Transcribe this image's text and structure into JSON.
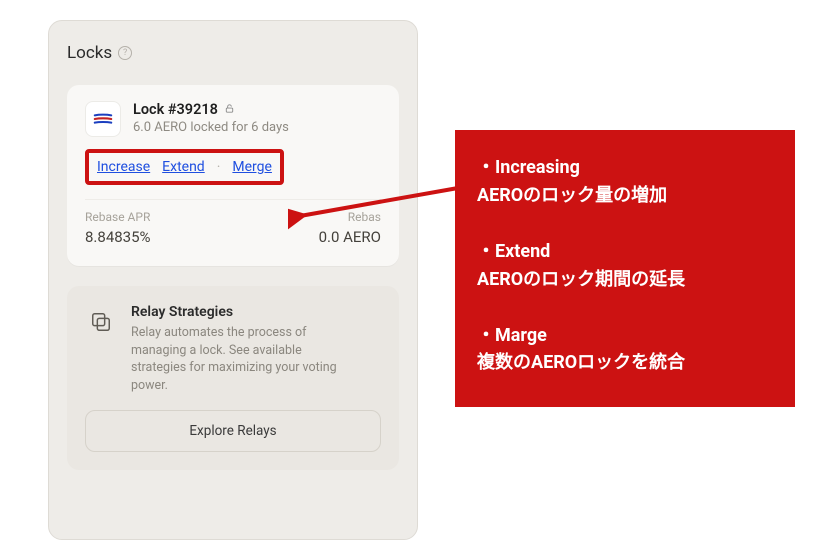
{
  "panel": {
    "title": "Locks"
  },
  "lock": {
    "title": "Lock #39218",
    "subtitle": "6.0 AERO locked for 6 days",
    "actions": {
      "increase": "Increase",
      "extend": "Extend",
      "merge": "Merge"
    },
    "stats": {
      "apr_label": "Rebase APR",
      "apr_value": "8.84835%",
      "reb_label": "Rebas",
      "reb_value": "0.0 AERO"
    }
  },
  "relay": {
    "title": "Relay Strategies",
    "desc": "Relay automates the process of managing a lock. See available strategies for maximizing your voting power.",
    "button": "Explore Relays"
  },
  "annotation": {
    "increasing_head": "・Increasing",
    "increasing_sub": "AEROのロック量の増加",
    "extend_head": "・Extend",
    "extend_sub": "AEROのロック期間の延長",
    "merge_head": "・Marge",
    "merge_sub": "複数のAEROロックを統合"
  }
}
